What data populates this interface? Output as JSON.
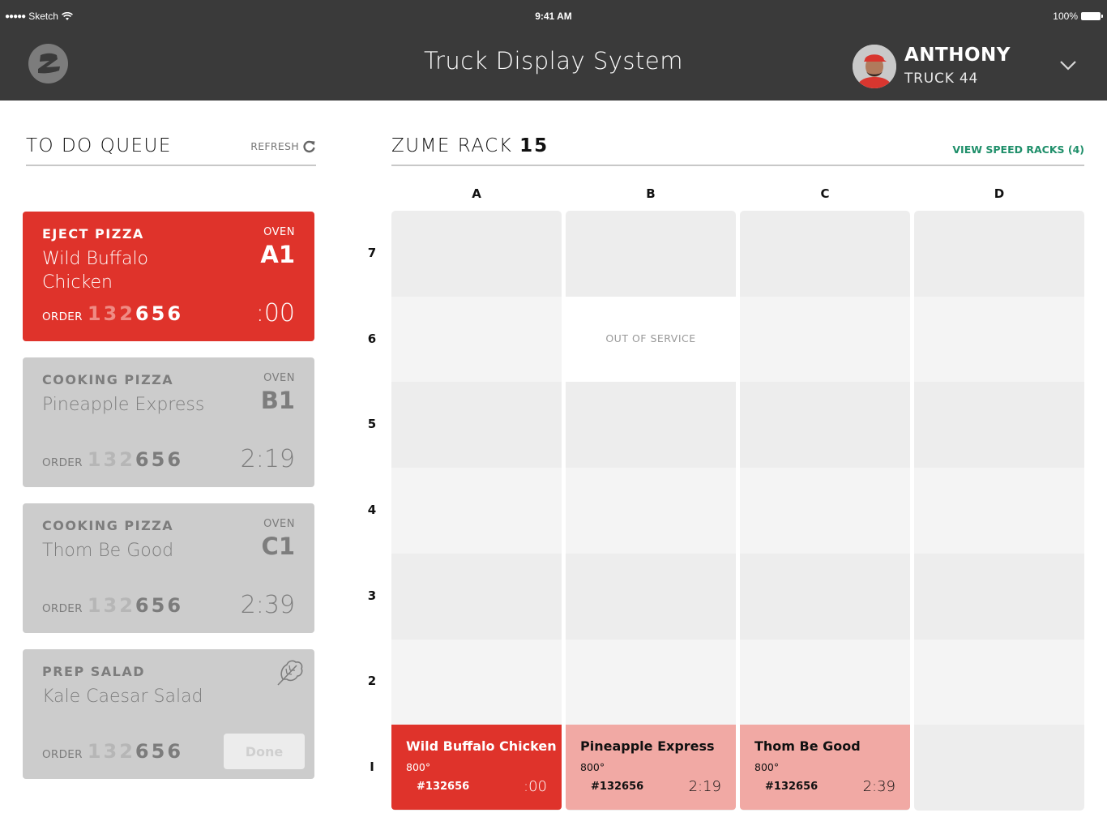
{
  "status_bar": {
    "carrier": "Sketch",
    "signal_dots": "●●●●●",
    "time": "9:41 AM",
    "battery": "100%"
  },
  "header": {
    "title": "Truck Display System",
    "user": {
      "name": "ANTHONY",
      "truck": "TRUCK 44"
    }
  },
  "queue": {
    "title": "TO DO QUEUE",
    "refresh_label": "REFRESH",
    "order_label": "ORDER",
    "oven_label": "OVEN",
    "cards": [
      {
        "task": "EJECT PIZZA",
        "item": "Wild Buffalo Chicken",
        "oven": "A1",
        "order_prefix": "132",
        "order_suffix": "656",
        "timer": ":00",
        "state": "active"
      },
      {
        "task": "COOKING PIZZA",
        "item": "Pineapple Express",
        "oven": "B1",
        "order_prefix": "132",
        "order_suffix": "656",
        "timer": "2:19",
        "state": "cooking"
      },
      {
        "task": "COOKING PIZZA",
        "item": "Thom Be Good",
        "oven": "C1",
        "order_prefix": "132",
        "order_suffix": "656",
        "timer": "2:39",
        "state": "cooking"
      },
      {
        "task": "PREP SALAD",
        "item": "Kale Caesar Salad",
        "order_prefix": "132",
        "order_suffix": "656",
        "done_label": "Done",
        "icon": "leaf-icon",
        "state": "prep"
      }
    ]
  },
  "rack": {
    "title": "ZUME RACK",
    "number": "15",
    "speed_racks_link": "VIEW SPEED RACKS (4)",
    "columns": [
      "A",
      "B",
      "C",
      "D"
    ],
    "rows": [
      "7",
      "6",
      "5",
      "4",
      "3",
      "2",
      "1"
    ],
    "out_of_service": {
      "column": "B",
      "row": "6",
      "label": "OUT OF SERVICE"
    },
    "pizzas": [
      {
        "column": "A",
        "row": "1",
        "name": "Wild Buffalo Chicken",
        "temp": "800°",
        "order": "#132656",
        "time": ":00",
        "state": "active"
      },
      {
        "column": "B",
        "row": "1",
        "name": "Pineapple Express",
        "temp": "800°",
        "order": "#132656",
        "time": "2:19",
        "state": "cooking"
      },
      {
        "column": "C",
        "row": "1",
        "name": "Thom Be Good",
        "temp": "800°",
        "order": "#132656",
        "time": "2:39",
        "state": "cooking"
      }
    ]
  },
  "colors": {
    "header_bg": "#3a3a3a",
    "active_red": "#df332b",
    "cooking_pink": "#f1a9a4",
    "queue_gray": "#cccccc",
    "link_green": "#1f8f6a"
  }
}
